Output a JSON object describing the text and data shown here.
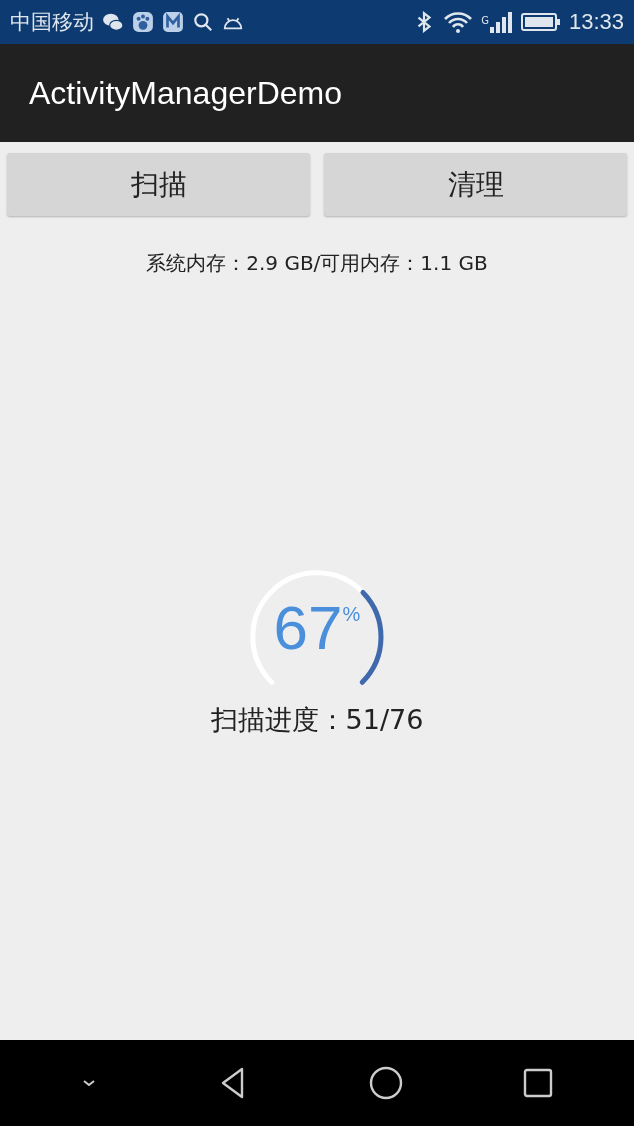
{
  "status_bar": {
    "carrier": "中国移动",
    "network": "G",
    "time": "13:33"
  },
  "app_bar": {
    "title": "ActivityManagerDemo"
  },
  "buttons": [
    {
      "label": "扫描"
    },
    {
      "label": "清理"
    }
  ],
  "memory_info": "系统内存：2.9 GB/可用内存：1.1 GB",
  "progress": {
    "value": "67",
    "unit": "%",
    "label": "扫描进度：51/76"
  }
}
